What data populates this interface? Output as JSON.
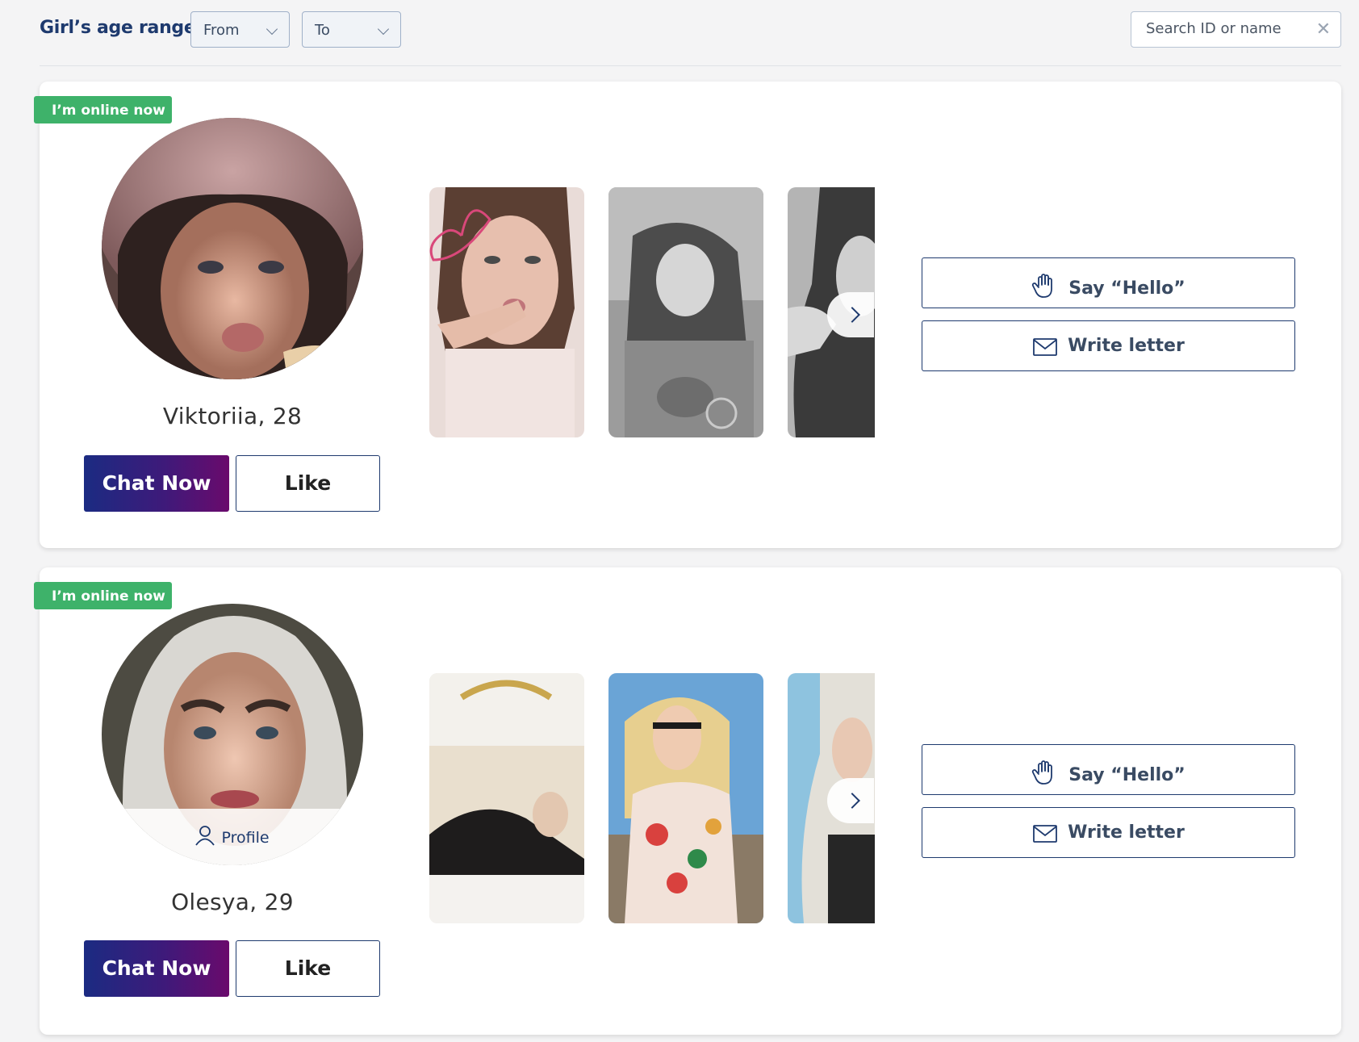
{
  "filters": {
    "age_label": "Girl’s age range",
    "from_label": "From",
    "to_label": "To",
    "search_placeholder": "Search ID or name"
  },
  "profiles": [
    {
      "status_badge": "I’m online now",
      "name": "Viktoriia, 28",
      "chat_label": "Chat Now",
      "like_label": "Like",
      "hello_label": "Say “Hello”",
      "letter_label": "Write letter",
      "profile_label": ""
    },
    {
      "status_badge": "I’m online now",
      "name": "Olesya, 29",
      "chat_label": "Chat Now",
      "like_label": "Like",
      "hello_label": "Say “Hello”",
      "letter_label": "Write letter",
      "profile_label": "Profile"
    }
  ],
  "colors": {
    "badge_green": "#3eb26a",
    "navy": "#1e3a6e",
    "chat_gradient_start": "#1b2b82",
    "chat_gradient_end": "#6a0a6c"
  },
  "icons": [
    "chevron-down-icon",
    "close-icon",
    "wave-hand-icon",
    "envelope-icon",
    "chevron-right-icon",
    "person-icon"
  ]
}
